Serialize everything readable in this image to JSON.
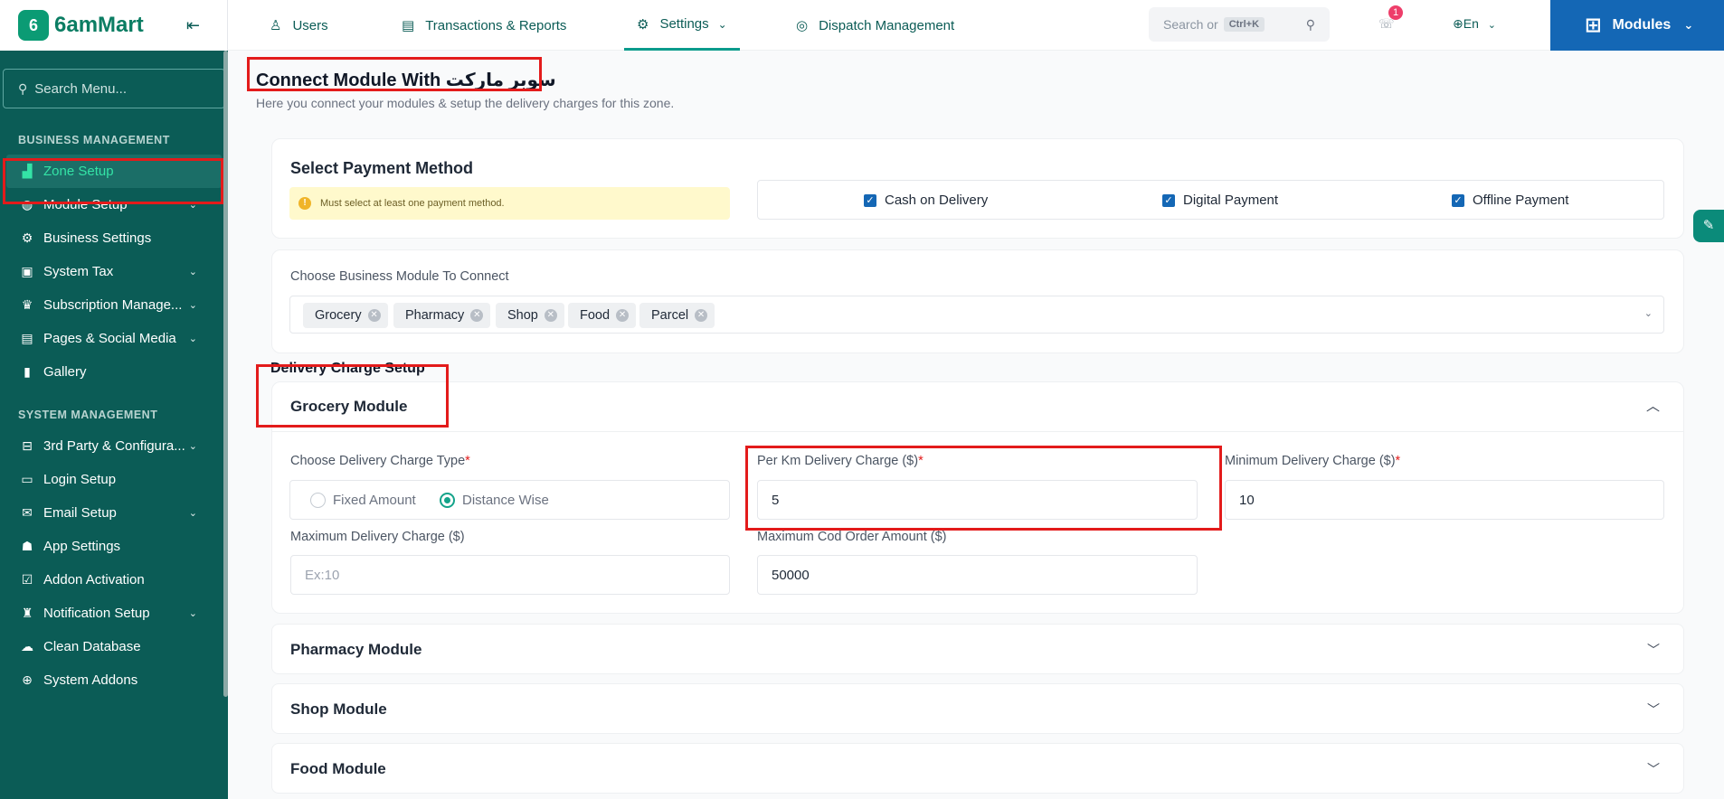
{
  "brand": {
    "name": "6amMart",
    "logo_letter": "6",
    "collapse_icon": "double-chevron-left-icon"
  },
  "sidebar": {
    "search_placeholder": "Search Menu...",
    "sections": [
      {
        "title": "BUSINESS MANAGEMENT"
      },
      {
        "title": "SYSTEM MANAGEMENT"
      }
    ],
    "business_items": [
      {
        "label": "Zone Setup",
        "icon": "map-icon",
        "active": true
      },
      {
        "label": "Module Setup",
        "icon": "globe-icon",
        "chevron": true
      },
      {
        "label": "Business Settings",
        "icon": "gear-icon"
      },
      {
        "label": "System Tax",
        "icon": "tax-icon",
        "chevron": true
      },
      {
        "label": "Subscription Manage...",
        "icon": "crown-icon",
        "chevron": true
      },
      {
        "label": "Pages & Social Media",
        "icon": "pages-icon",
        "chevron": true
      },
      {
        "label": "Gallery",
        "icon": "gallery-icon"
      }
    ],
    "system_items": [
      {
        "label": "3rd Party & Configura...",
        "icon": "plug-icon",
        "chevron": true
      },
      {
        "label": "Login Setup",
        "icon": "monitor-icon"
      },
      {
        "label": "Email Setup",
        "icon": "mail-icon",
        "chevron": true
      },
      {
        "label": "App Settings",
        "icon": "android-icon"
      },
      {
        "label": "Addon Activation",
        "icon": "calendar-check-icon"
      },
      {
        "label": "Notification Setup",
        "icon": "bell-icon",
        "chevron": true
      },
      {
        "label": "Clean Database",
        "icon": "cloud-icon"
      },
      {
        "label": "System Addons",
        "icon": "plus-circle-icon"
      }
    ]
  },
  "topbar": {
    "nav": [
      {
        "label": "Users",
        "icon": "user-icon"
      },
      {
        "label": "Transactions & Reports",
        "icon": "report-icon"
      },
      {
        "label": "Settings",
        "icon": "gear-icon",
        "active": true
      },
      {
        "label": "Dispatch Management",
        "icon": "dispatch-icon"
      }
    ],
    "search_placeholder": "Search or",
    "search_shortcut": "Ctrl+K",
    "notification_count": "1",
    "language": "En",
    "modules_label": "Modules"
  },
  "page": {
    "title": "Connect Module With سوبر ماركت",
    "subtitle": "Here you connect your modules & setup the delivery charges for this zone."
  },
  "payment": {
    "title": "Select Payment Method",
    "warning": "Must select at least one payment method.",
    "options": [
      {
        "label": "Cash on Delivery",
        "checked": true
      },
      {
        "label": "Digital Payment",
        "checked": true
      },
      {
        "label": "Offline Payment",
        "checked": true
      }
    ]
  },
  "business_module": {
    "label": "Choose Business Module To Connect",
    "chips": [
      "Grocery",
      "Pharmacy",
      "Shop",
      "Food",
      "Parcel"
    ]
  },
  "delivery": {
    "section_label": "Delivery Charge Setup",
    "grocery": {
      "title": "Grocery Module",
      "charge_type_label": "Choose Delivery Charge Type",
      "charge_type_options": [
        {
          "label": "Fixed Amount",
          "selected": false
        },
        {
          "label": "Distance Wise",
          "selected": true
        }
      ],
      "per_km_label": "Per Km Delivery Charge ($)",
      "per_km_value": "5",
      "min_label": "Minimum Delivery Charge ($)",
      "min_value": "10",
      "max_label": "Maximum Delivery Charge ($)",
      "max_placeholder": "Ex:10",
      "max_cod_label": "Maximum Cod Order Amount ($)",
      "max_cod_value": "50000"
    },
    "collapsed_modules": [
      "Pharmacy Module",
      "Shop Module",
      "Food Module"
    ]
  },
  "colors": {
    "sidebar": "#0b5c56",
    "accent": "#14a38a",
    "modules": "#1467b5",
    "highlight": "#e31b1b"
  }
}
